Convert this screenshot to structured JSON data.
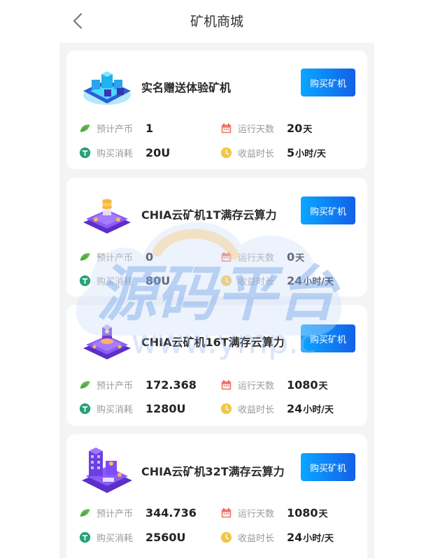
{
  "header": {
    "title": "矿机商城"
  },
  "labels": {
    "produce": "预计产币",
    "run_days": "运行天数",
    "cost": "购买消耗",
    "duration": "收益时长",
    "buy": "购买矿机"
  },
  "watermark": {
    "text": "源码平台",
    "sub": "www.ymp.c"
  },
  "products": [
    {
      "name": "实名赠送体验矿机",
      "produce": "1",
      "days": "20",
      "days_unit": "天",
      "cost": "20U",
      "hours": "5",
      "hours_unit": "小时/天"
    },
    {
      "name": "CHIA云矿机1T满存云算力",
      "produce": "0",
      "days": "0",
      "days_unit": "天",
      "cost": "80U",
      "hours": "24",
      "hours_unit": "小时/天"
    },
    {
      "name": "CHIA云矿机16T满存云算力",
      "produce": "172.368",
      "days": "1080",
      "days_unit": "天",
      "cost": "1280U",
      "hours": "24",
      "hours_unit": "小时/天"
    },
    {
      "name": "CHIA云矿机32T满存云算力",
      "produce": "344.736",
      "days": "1080",
      "days_unit": "天",
      "cost": "2560U",
      "hours": "24",
      "hours_unit": "小时/天"
    }
  ],
  "colors": {
    "button_start": "#0aa7ff",
    "button_end": "#1260ea",
    "leaf": "#5bb84a",
    "calendar": "#f07a6a",
    "tether": "#26a17b",
    "clock": "#f5c542"
  }
}
